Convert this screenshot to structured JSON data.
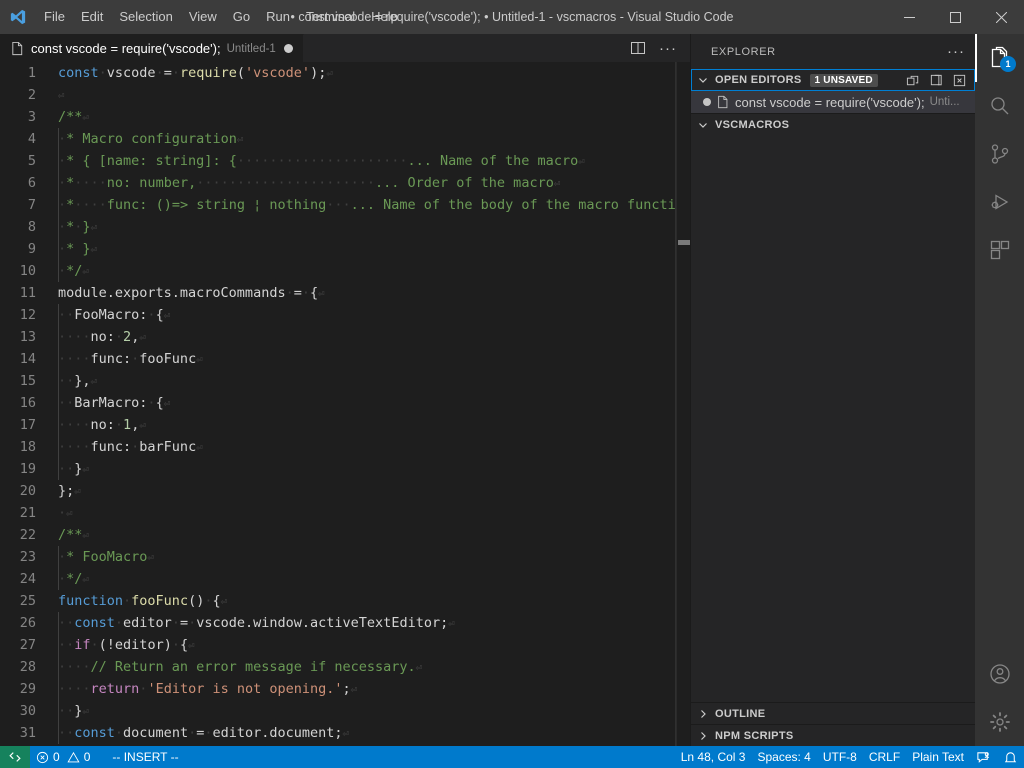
{
  "window": {
    "title": "• const vscode = require('vscode'); • Untitled-1 - vscmacros - Visual Studio Code",
    "app_icon": "vscode-logo-icon",
    "minimize_label": "—",
    "maximize_label": "▢",
    "close_label": "✕"
  },
  "menubar": {
    "items": [
      {
        "label": "File"
      },
      {
        "label": "Edit"
      },
      {
        "label": "Selection"
      },
      {
        "label": "View"
      },
      {
        "label": "Go"
      },
      {
        "label": "Run"
      },
      {
        "label": "Terminal"
      },
      {
        "label": "Help"
      }
    ]
  },
  "editor": {
    "tab": {
      "label": "const vscode = require('vscode');",
      "description": "Untitled-1",
      "dirty": true
    },
    "actions": {
      "split_editor": "split-editor-icon",
      "more_actions": "···"
    },
    "lines": [
      {
        "no": "1",
        "html": "<span class='kw'>const</span><span class='ws'>·</span><span class='plain'>vscode</span><span class='ws'>·</span><span class='plain'>=</span><span class='ws'>·</span><span class='fn'>require</span><span class='plain'>(</span><span class='str'>'vscode'</span><span class='plain'>);</span><span class='eol'>⏎</span>"
      },
      {
        "no": "2",
        "html": "<span class='eol'>⏎</span>"
      },
      {
        "no": "3",
        "html": "<span class='cmt'>/**</span><span class='eol'>⏎</span>"
      },
      {
        "no": "4",
        "html": "<span class='iguide'></span><span class='ws'>·</span><span class='cmt'>* Macro configuration</span><span class='eol'>⏎</span>"
      },
      {
        "no": "5",
        "html": "<span class='iguide'></span><span class='ws'>·</span><span class='cmt'>* { [name: string]: {</span><span class='ws'>·····················</span><span class='cmt'>... Name of the macro</span><span class='eol'>⏎</span>"
      },
      {
        "no": "6",
        "html": "<span class='iguide'></span><span class='ws'>·</span><span class='cmt'>*</span><span class='ws'>····</span><span class='cmt'>no: number,</span><span class='ws'>······················</span><span class='cmt'>... Order of the macro</span><span class='eol'>⏎</span>"
      },
      {
        "no": "7",
        "html": "<span class='iguide'></span><span class='ws'>·</span><span class='cmt'>*</span><span class='ws'>····</span><span class='cmt'>func: ()=> string ¦ nothing</span><span class='ws'>···</span><span class='cmt'>... Name of the body of the macro function</span>"
      },
      {
        "no": "8",
        "html": "<span class='iguide'></span><span class='ws'>·</span><span class='cmt'>*</span><span class='ws'>·</span><span class='cmt'>}</span><span class='eol'>⏎</span>"
      },
      {
        "no": "9",
        "html": "<span class='iguide'></span><span class='ws'>·</span><span class='cmt'>* }</span><span class='eol'>⏎</span>"
      },
      {
        "no": "10",
        "html": "<span class='iguide'></span><span class='ws'>·</span><span class='cmt'>*/</span><span class='eol'>⏎</span>"
      },
      {
        "no": "11",
        "html": "<span class='plain'>module.exports.macroCommands</span><span class='ws'>·</span><span class='plain'>=</span><span class='ws'>·</span><span class='plain'>{</span><span class='eol'>⏎</span>"
      },
      {
        "no": "12",
        "html": "<span class='iguide'></span><span class='ws'>··</span><span class='plain'>FooMacro:</span><span class='ws'>·</span><span class='plain'>{</span><span class='eol'>⏎</span>"
      },
      {
        "no": "13",
        "html": "<span class='iguide'></span><span class='ws'>····</span><span class='plain'>no:</span><span class='ws'>·</span><span class='num'>2</span><span class='plain'>,</span><span class='eol'>⏎</span>"
      },
      {
        "no": "14",
        "html": "<span class='iguide'></span><span class='ws'>····</span><span class='plain'>func:</span><span class='ws'>·</span><span class='plain'>fooFunc</span><span class='eol'>⏎</span>"
      },
      {
        "no": "15",
        "html": "<span class='iguide'></span><span class='ws'>··</span><span class='plain'>},</span><span class='eol'>⏎</span>"
      },
      {
        "no": "16",
        "html": "<span class='iguide'></span><span class='ws'>··</span><span class='plain'>BarMacro:</span><span class='ws'>·</span><span class='plain'>{</span><span class='eol'>⏎</span>"
      },
      {
        "no": "17",
        "html": "<span class='iguide'></span><span class='ws'>····</span><span class='plain'>no:</span><span class='ws'>·</span><span class='num'>1</span><span class='plain'>,</span><span class='eol'>⏎</span>"
      },
      {
        "no": "18",
        "html": "<span class='iguide'></span><span class='ws'>····</span><span class='plain'>func:</span><span class='ws'>·</span><span class='plain'>barFunc</span><span class='eol'>⏎</span>"
      },
      {
        "no": "19",
        "html": "<span class='iguide'></span><span class='ws'>··</span><span class='plain'>}</span><span class='eol'>⏎</span>"
      },
      {
        "no": "20",
        "html": "<span class='plain'>};</span><span class='eol'>⏎</span>"
      },
      {
        "no": "21",
        "html": "<span class='ws'>·</span><span class='eol'>⏎</span>"
      },
      {
        "no": "22",
        "html": "<span class='cmt'>/**</span><span class='eol'>⏎</span>"
      },
      {
        "no": "23",
        "html": "<span class='iguide'></span><span class='ws'>·</span><span class='cmt'>* FooMacro</span><span class='eol'>⏎</span>"
      },
      {
        "no": "24",
        "html": "<span class='iguide'></span><span class='ws'>·</span><span class='cmt'>*/</span><span class='eol'>⏎</span>"
      },
      {
        "no": "25",
        "html": "<span class='kw'>function</span><span class='ws'>·</span><span class='fn'>fooFunc</span><span class='plain'>()</span><span class='ws'>·</span><span class='plain'>{</span><span class='eol'>⏎</span>"
      },
      {
        "no": "26",
        "html": "<span class='iguide'></span><span class='ws'>··</span><span class='kw'>const</span><span class='ws'>·</span><span class='plain'>editor</span><span class='ws'>·</span><span class='plain'>=</span><span class='ws'>·</span><span class='plain'>vscode.window.activeTextEditor;</span><span class='eol'>⏎</span>"
      },
      {
        "no": "27",
        "html": "<span class='iguide'></span><span class='ws'>··</span><span class='kw2'>if</span><span class='ws'>·</span><span class='plain'>(!editor)</span><span class='ws'>·</span><span class='plain'>{</span><span class='eol'>⏎</span>"
      },
      {
        "no": "28",
        "html": "<span class='iguide'></span><span class='ws'>····</span><span class='cmt'>// Return an error message if necessary.</span><span class='eol'>⏎</span>"
      },
      {
        "no": "29",
        "html": "<span class='iguide'></span><span class='ws'>····</span><span class='kw2'>return</span><span class='ws'>·</span><span class='str'>'Editor is not opening.'</span><span class='plain'>;</span><span class='eol'>⏎</span>"
      },
      {
        "no": "30",
        "html": "<span class='iguide'></span><span class='ws'>··</span><span class='plain'>}</span><span class='eol'>⏎</span>"
      },
      {
        "no": "31",
        "html": "<span class='iguide'></span><span class='ws'>··</span><span class='kw'>const</span><span class='ws'>·</span><span class='plain'>document</span><span class='ws'>·</span><span class='plain'>=</span><span class='ws'>·</span><span class='plain'>editor.document;</span><span class='eol'>⏎</span>"
      }
    ]
  },
  "sidebar": {
    "title": "EXPLORER",
    "more_label": "···",
    "open_editors": {
      "label": "OPEN EDITORS",
      "badge": "1 UNSAVED",
      "actions": [
        {
          "name": "new-untitled-file-icon"
        },
        {
          "name": "split-editor-icon"
        },
        {
          "name": "close-all-editors-icon"
        }
      ],
      "rows": [
        {
          "dirty": true,
          "name": "const vscode = require('vscode');",
          "description": "Unti..."
        }
      ]
    },
    "folder": {
      "label": "VSCMACROS"
    },
    "outline": {
      "label": "OUTLINE"
    },
    "npm_scripts": {
      "label": "NPM SCRIPTS"
    }
  },
  "activitybar": {
    "items": [
      {
        "name": "explorer-icon",
        "active": true,
        "badge": "1"
      },
      {
        "name": "search-icon",
        "active": false,
        "badge": ""
      },
      {
        "name": "source-control-icon",
        "active": false,
        "badge": ""
      },
      {
        "name": "run-and-debug-icon",
        "active": false,
        "badge": ""
      },
      {
        "name": "extensions-icon",
        "active": false,
        "badge": ""
      }
    ],
    "bottom": [
      {
        "name": "account-icon"
      },
      {
        "name": "settings-gear-icon"
      }
    ]
  },
  "statusbar": {
    "remote_icon": "remote-host-icon",
    "errors": "0",
    "warnings": "0",
    "mode": "-- INSERT --",
    "position": "Ln 48, Col 3",
    "indentation": "Spaces: 4",
    "encoding": "UTF-8",
    "eol": "CRLF",
    "language": "Plain Text",
    "feedback_icon": "feedback-icon",
    "bell_icon": "bell-icon"
  },
  "colors": {
    "titlebar_bg": "#3c3c3c",
    "editor_bg": "#1e1e1e",
    "sidebar_bg": "#252526",
    "activitybar_bg": "#333333",
    "statusbar_bg": "#007acc",
    "remote_bg": "#16825d",
    "focus_border": "#007fd4",
    "badge_bg": "#007acc"
  }
}
